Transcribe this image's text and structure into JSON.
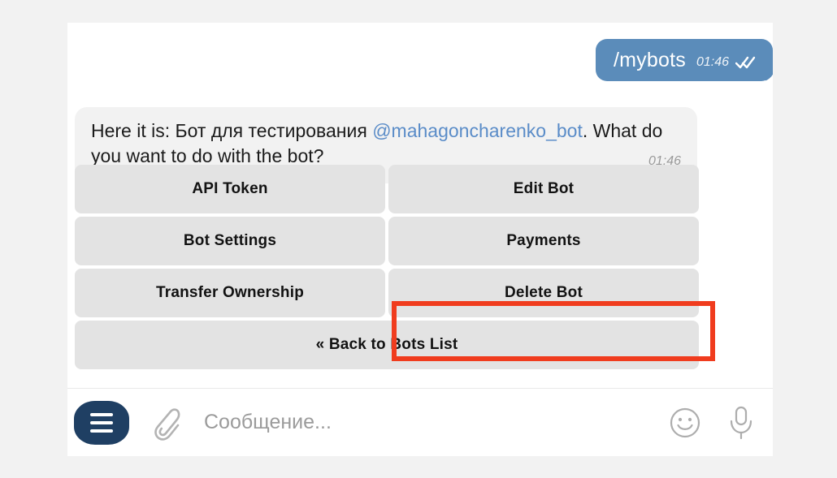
{
  "chat": {
    "outgoing_message": {
      "text": "/mybots",
      "time": "01:46",
      "status_icon": "double-check-icon"
    },
    "incoming_message": {
      "text_before_link": "Here it is: Бот для тестирования ",
      "link": "@mahagoncharenko_bot",
      "text_after_link": ". What do you want to do with the bot?",
      "time": "01:46"
    },
    "keyboard_rows": [
      [
        "API Token",
        "Edit Bot"
      ],
      [
        "Bot Settings",
        "Payments"
      ],
      [
        "Transfer Ownership",
        "Delete Bot"
      ],
      [
        "« Back to Bots List"
      ]
    ],
    "highlighted_button": "Edit Bot"
  },
  "composer": {
    "menu_icon": "hamburger-menu-icon",
    "attach_icon": "paperclip-icon",
    "input_placeholder": "Сообщение...",
    "emoji_icon": "smiley-icon",
    "voice_icon": "microphone-icon"
  },
  "colors": {
    "outgoing_bubble": "#5b8cba",
    "incoming_bubble": "#f2f2f2",
    "keyboard_button": "#e3e3e3",
    "highlight": "#f03c1e",
    "menu_button": "#1f3f63",
    "link": "#5a8cc8"
  }
}
